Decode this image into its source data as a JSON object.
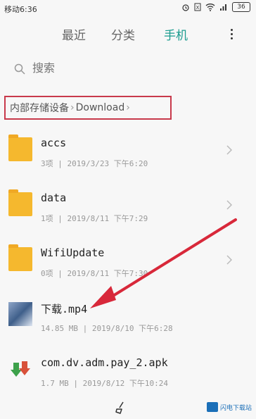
{
  "status": {
    "time": "移动6:36",
    "battery": "36"
  },
  "tabs": [
    {
      "label": "最近"
    },
    {
      "label": "分类"
    },
    {
      "label": "手机"
    }
  ],
  "search": {
    "placeholder": "搜索"
  },
  "breadcrumb": {
    "root": "内部存储设备",
    "folder": "Download"
  },
  "files": [
    {
      "name": "accs",
      "meta": "3项 | 2019/3/23  下午6:20",
      "type": "folder"
    },
    {
      "name": "data",
      "meta": "1项 | 2019/8/11  下午7:29",
      "type": "folder"
    },
    {
      "name": "WifiUpdate",
      "meta": "0项 | 2019/8/11  下午7:30",
      "type": "folder"
    },
    {
      "name": "下载.mp4",
      "meta": "14.85 MB | 2019/8/10  下午6:28",
      "type": "video"
    },
    {
      "name": "com.dv.adm.pay_2.apk",
      "meta": "1.7 MB | 2019/8/12  下午10:24",
      "type": "apk"
    }
  ],
  "watermark": {
    "text": "闪电下载站"
  },
  "colors": {
    "accent": "#1b9c8f",
    "highlight": "#c8394b",
    "arrow": "#d8283a",
    "folder": "#f5b82e"
  }
}
